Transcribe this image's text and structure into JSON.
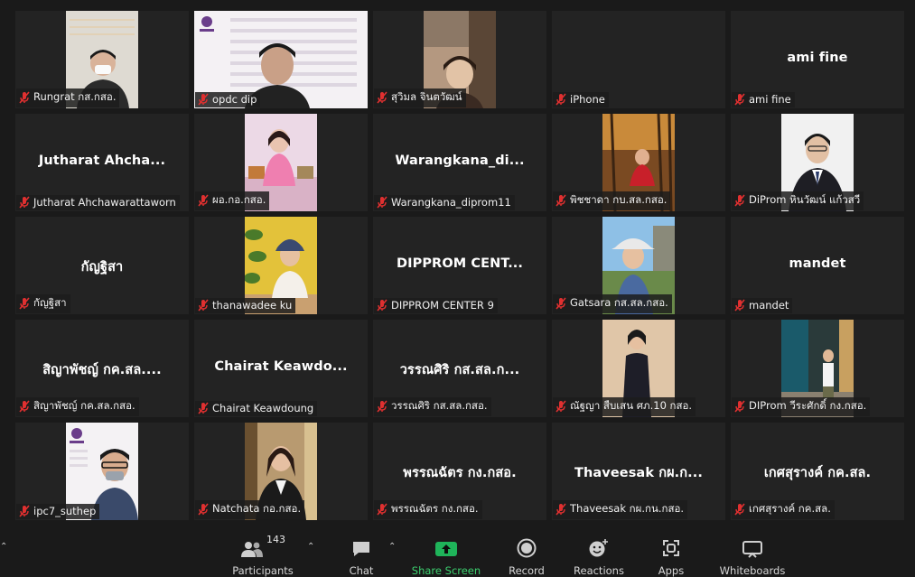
{
  "participants": [
    {
      "label": "Rungrat กส.กสอ.",
      "display": ""
    },
    {
      "label": "opdc dip",
      "display": ""
    },
    {
      "label": "สุวิมล จินตวัฒน์",
      "display": ""
    },
    {
      "label": "iPhone",
      "display": ""
    },
    {
      "label": "ami fine",
      "display": "ami fine"
    },
    {
      "label": "Jutharat Ahchawarattaworn",
      "display": "Jutharat  Ahcha..."
    },
    {
      "label": "ผอ.กอ.กสอ.",
      "display": ""
    },
    {
      "label": "Warangkana_diprom11",
      "display": "Warangkana_di..."
    },
    {
      "label": "พิชชาดา กบ.สล.กสอ.",
      "display": ""
    },
    {
      "label": "DiProm หินวัฒน์ แก้วสวี",
      "display": ""
    },
    {
      "label": "กัญฐิสา",
      "display": "กัญฐิสา"
    },
    {
      "label": "thanawadee ku",
      "display": ""
    },
    {
      "label": "DIPPROM CENTER 9",
      "display": "DIPPROM  CENT..."
    },
    {
      "label": "Gatsara กส.สล.กสอ.",
      "display": ""
    },
    {
      "label": "mandet",
      "display": "mandet"
    },
    {
      "label": "สิญาพัชญ์ กค.สล.กสอ.",
      "display": "สิญาพัชญ์ กค.สล...."
    },
    {
      "label": "Chairat Keawdoung",
      "display": "Chairat  Keawdo..."
    },
    {
      "label": "วรรณศิริ กส.สล.กสอ.",
      "display": "วรรณศิริ กส.สล.ก..."
    },
    {
      "label": "ณัฐญา สืบเสน ศภ.10 กสอ.",
      "display": ""
    },
    {
      "label": "DIProm วีระศักดิ์ กง.กสอ.",
      "display": ""
    },
    {
      "label": "ipc7_suthep",
      "display": ""
    },
    {
      "label": "Natchata กอ.กสอ.",
      "display": ""
    },
    {
      "label": "พรรณฉัตร กง.กสอ.",
      "display": "พรรณฉัตร กง.กสอ."
    },
    {
      "label": "Thaveesak กผ.กน.กสอ.",
      "display": "Thaveesak กผ.ก..."
    },
    {
      "label": "เกศสุรางค์ กค.สล.",
      "display": "เกศสุรางค์ กค.สล."
    }
  ],
  "toolbar": {
    "participants_label": "Participants",
    "participants_count": "143",
    "chat_label": "Chat",
    "share_label": "Share Screen",
    "record_label": "Record",
    "reactions_label": "Reactions",
    "apps_label": "Apps",
    "whiteboards_label": "Whiteboards"
  },
  "colors": {
    "share_green": "#1fb45a",
    "muted_red": "#e03030",
    "tile_bg": "#232323",
    "background": "#1a1a1a"
  }
}
